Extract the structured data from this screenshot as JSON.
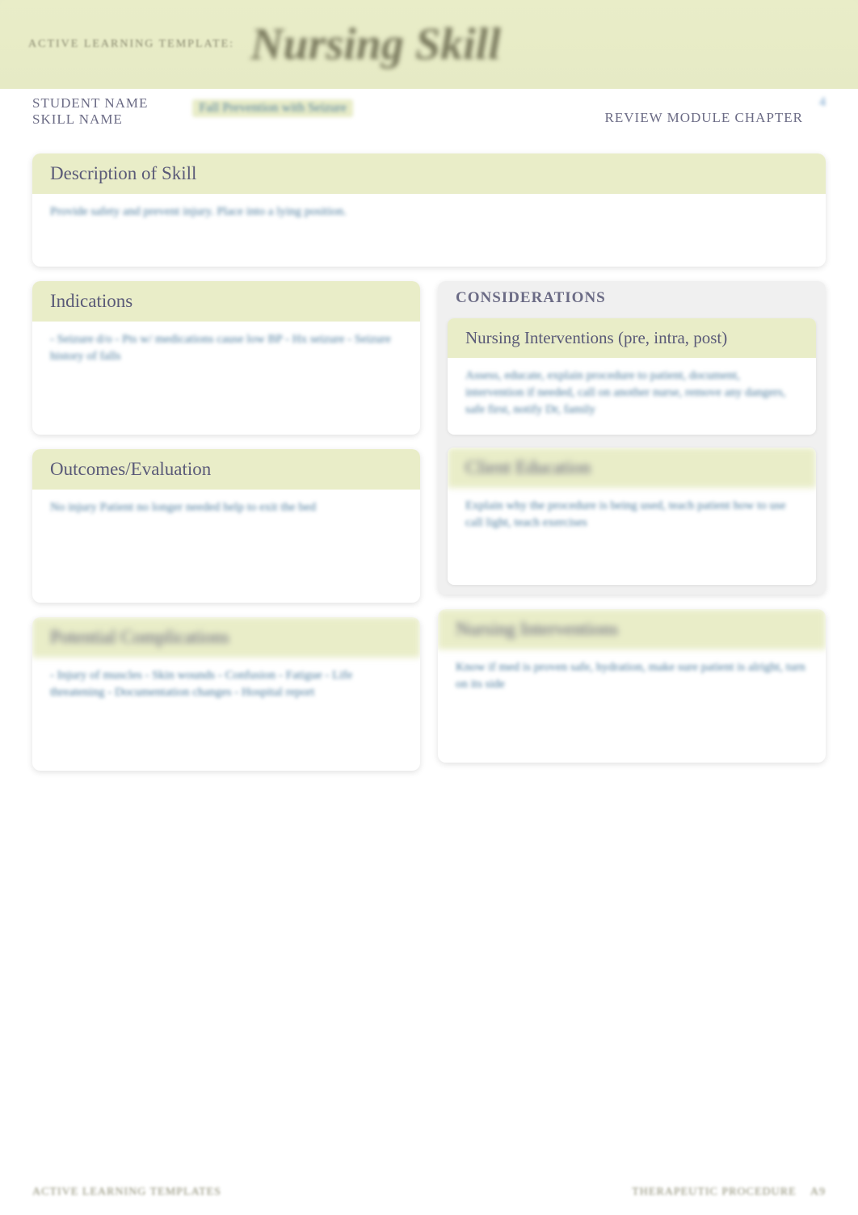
{
  "header": {
    "template_label": "ACTIVE LEARNING TEMPLATE:",
    "skill_title": "Nursing Skill"
  },
  "meta": {
    "student_name_label": "STUDENT NAME",
    "student_name_value": "",
    "skill_name_label": "SKILL NAME",
    "skill_name_value": "Fall Prevention with Seizure",
    "review_label": "REVIEW MODULE CHAPTER",
    "review_value": "4"
  },
  "sections": {
    "description": {
      "header": "Description of Skill",
      "body": "Provide safety and prevent injury. Place into a lying position."
    },
    "considerations_label": "CONSIDERATIONS",
    "indications": {
      "header": "Indications",
      "body": "- Seizure d/o\n- Pts w/ medications cause low BP\n- Hx seizure\n- Seizure history of falls"
    },
    "interventions_pre": {
      "header": "Nursing Interventions (pre, intra, post)",
      "body": "Assess, educate, explain procedure to patient, document, intervention if needed, call on another nurse, remove any dangers, safe first, notify Dr, family"
    },
    "outcomes": {
      "header": "Outcomes/Evaluation",
      "body": "No injury\nPatient no longer needed help to exit the bed"
    },
    "client_education": {
      "header": "Client Education",
      "body": "Explain why the procedure is being used, teach patient how to use call light, teach exercises"
    },
    "complications": {
      "header": "Potential Complications",
      "body": "- Injury of muscles\n- Skin wounds\n- Confusion\n- Fatigue\n- Life threatening\n- Documentation changes\n- Hospital report"
    },
    "nursing_interventions": {
      "header": "Nursing Interventions",
      "body": "Know if med is proven safe, hydration, make sure patient is alright, turn on its side"
    }
  },
  "footer": {
    "left": "ACTIVE LEARNING TEMPLATES",
    "right": "THERAPEUTIC PROCEDURE",
    "page": "A9"
  }
}
